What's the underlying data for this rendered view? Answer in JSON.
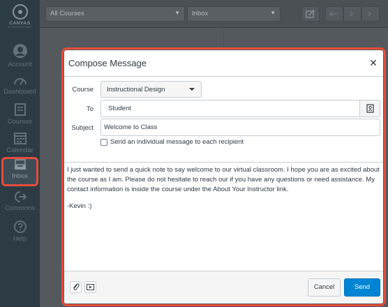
{
  "brand": {
    "word": "CANVAS",
    "sub": "BY INSTRUCTURE"
  },
  "nav": {
    "account": "Account",
    "dashboard": "Dashboard",
    "courses": "Courses",
    "calendar": "Calendar",
    "inbox": "Inbox",
    "commons": "Commons",
    "help": "Help"
  },
  "toolbar": {
    "course_filter": "All Courses",
    "mailbox_filter": "Inbox"
  },
  "compose": {
    "title": "Compose Message",
    "course_label": "Course",
    "course_value": "Instructional Design",
    "to_label": "To",
    "to_value": "Student",
    "subject_label": "Subject",
    "subject_value": "Welcome to Class",
    "individual_label": "Send an individual message to each recipient",
    "individual_checked": false,
    "body_paragraph": "I just wanted to send a quick note to say welcome to our virtual classroom. I hope you are as excited about the course as I am. Please do not hesitate to reach our if you have any questions or need assistance. My contact information is inside the course under the About Your Instructor link.",
    "body_signoff": "-Kevin :)",
    "cancel_label": "Cancel",
    "send_label": "Send",
    "close_glyph": "✕"
  },
  "colors": {
    "nav_bg": "#2d3b45",
    "highlight": "#e74c3c",
    "send_button": "#0084d4"
  },
  "icons": [
    "canvas-logo-icon",
    "account-icon",
    "dashboard-icon",
    "courses-icon",
    "calendar-icon",
    "inbox-icon",
    "commons-icon",
    "help-icon",
    "compose-icon",
    "reply-icon",
    "reply-all-icon",
    "archive-icon",
    "address-book-icon",
    "paperclip-icon",
    "media-icon",
    "close-icon"
  ]
}
